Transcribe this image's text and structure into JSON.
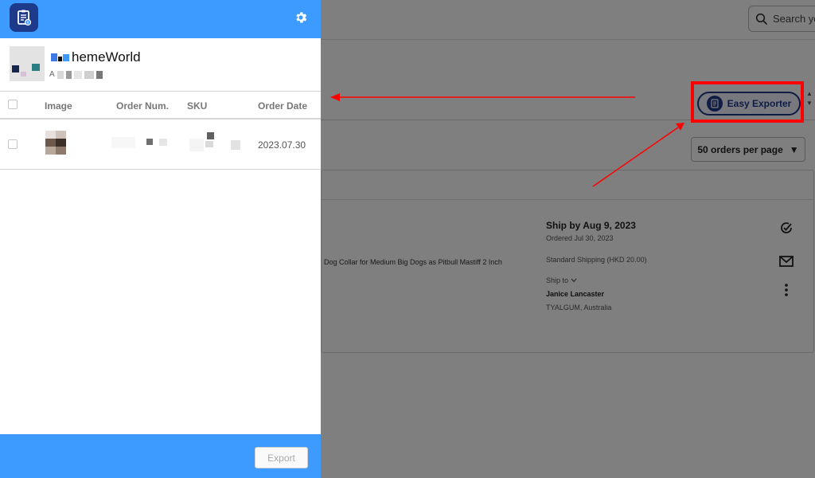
{
  "background": {
    "search": {
      "placeholder": "Search yo"
    },
    "easy_exporter": {
      "label": "Easy Exporter"
    },
    "per_page": {
      "label": "50 orders per page"
    },
    "order": {
      "product_title": "Dog Collar for Medium Big Dogs as Pitbull Mastiff 2 Inch",
      "ship_by": "Ship by Aug 9, 2023",
      "ordered": "Ordered Jul 30, 2023",
      "shipping_method": "Standard Shipping  (HKD 20.00)",
      "ship_to_label": "Ship to",
      "customer_name": "Janice Lancaster",
      "customer_location": "TYALGUM, Australia"
    }
  },
  "extension": {
    "store": {
      "name": "hemeWorld",
      "sub_prefix": "A"
    },
    "table": {
      "headers": {
        "image": "Image",
        "order_num": "Order Num.",
        "sku": "SKU",
        "order_date": "Order Date"
      },
      "rows": [
        {
          "order_date": "2023.07.30"
        }
      ]
    },
    "footer": {
      "export_label": "Export"
    }
  },
  "icons": {
    "logo": "clipboard-icon",
    "settings": "gear-icon",
    "search": "search-icon",
    "exporter": "document-icon",
    "complete": "check-circle-icon",
    "message": "mail-icon",
    "more": "more-vertical-icon",
    "dropdown": "caret-down-icon",
    "ship_to": "chevron-down-icon"
  },
  "colors": {
    "header_blue": "#3d9bff",
    "logo_navy": "#1e3a8a",
    "annotation_red": "#ff0000",
    "overlay": "#000000"
  }
}
